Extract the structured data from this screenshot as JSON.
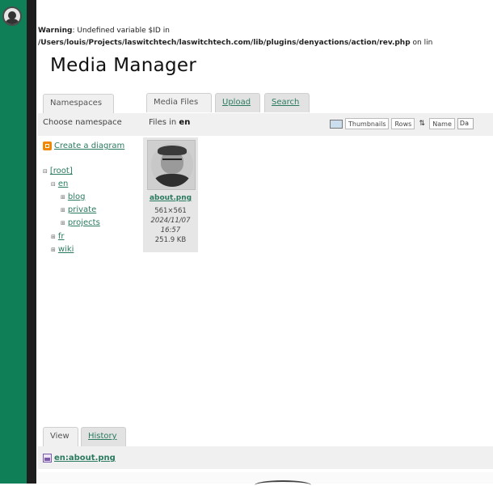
{
  "warning": {
    "label": "Warning",
    "text": ": Undefined variable $ID in",
    "path": "/Users/louis/Projects/laswitchtech/laswitchtech.com/lib/plugins/denyactions/action/rev.php",
    "suffix": " on lin"
  },
  "title": "Media Manager",
  "tabs": {
    "namespaces": "Namespaces",
    "media_files": "Media Files",
    "upload": "Upload",
    "search": "Search"
  },
  "namespace_panel": {
    "heading": "Choose namespace",
    "create_label": "Create a diagram"
  },
  "tree": {
    "root": "[root]",
    "en": "en",
    "blog": "blog",
    "private": "private",
    "projects": "projects",
    "fr": "fr",
    "wiki": "wiki"
  },
  "files_panel": {
    "heading_prefix": "Files in ",
    "heading_ns": "en",
    "view_thumbnails": "Thumbnails",
    "view_rows": "Rows",
    "sort_label": "Name",
    "sort_value": "Da"
  },
  "file": {
    "name": "about.png",
    "dimensions": "561×561",
    "date": "2024/11/07",
    "time": "16:57",
    "size": "251.9 KB"
  },
  "bottom_tabs": {
    "view": "View",
    "history": "History"
  },
  "selected_file": "en:about.png"
}
